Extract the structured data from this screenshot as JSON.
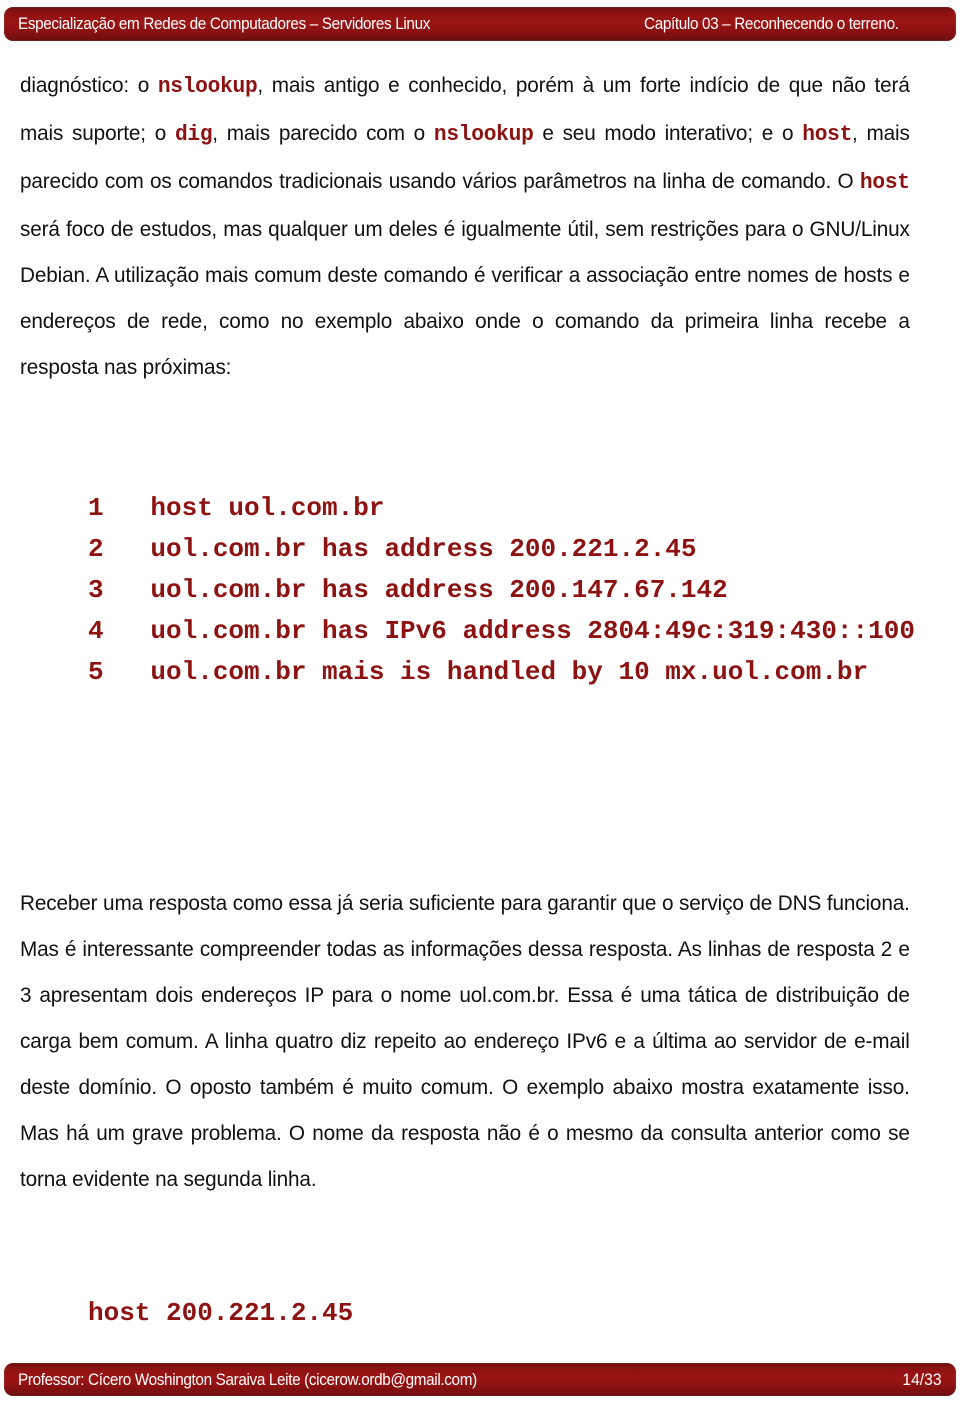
{
  "header": {
    "course_title": "Especialização em Redes de Computadores – Servidores Linux",
    "chapter": "Capítulo 03 – Reconhecendo o terreno."
  },
  "footer": {
    "professor": "Professor: Cícero Woshington Saraiva Leite (cicerow.ordb@gmail.com)",
    "page": "14/33"
  },
  "colors": {
    "bar_red": "#8e1212",
    "code_red": "#8d1313",
    "body_text": "#111111",
    "page_background": "#ffffff"
  },
  "body": {
    "paragraph_1": {
      "run_1": "diagnóstico: o ",
      "code_1": "nslookup",
      "run_2": ", mais antigo e conhecido, porém à um forte indício de que não terá mais suporte; o ",
      "code_2": "dig",
      "run_3": ", mais parecido com o ",
      "code_3": "nslookup",
      "run_4": " e seu modo interativo; e o ",
      "code_4": "host",
      "run_5": ", mais parecido com os comandos tradicionais usando vários parâmetros na linha de comando. O ",
      "code_5": "host",
      "run_6": " será foco de estudos, mas qualquer um deles é igualmente útil, sem restrições para o GNU/Linux Debian. A utilização mais comum deste comando é verificar a associação entre nomes de hosts e endereços de rede, como no exemplo abaixo onde o comando da primeira linha recebe a resposta nas próximas:"
    },
    "code_block_1": {
      "lines": [
        "1   host uol.com.br",
        "2   uol.com.br has address 200.221.2.45",
        "3   uol.com.br has address 200.147.67.142",
        "4   uol.com.br has IPv6 address 2804:49c:319:430::100",
        "5   uol.com.br mais is handled by 10 mx.uol.com.br"
      ]
    },
    "paragraph_2": "Receber uma resposta como essa já seria suficiente para garantir que o serviço de DNS funciona. Mas é interessante compreender todas as informações dessa resposta. As linhas de resposta 2 e 3 apresentam dois endereços IP para o nome uol.com.br. Essa é uma tática de distribuição de carga bem comum. A linha quatro diz repeito ao endereço IPv6 e a última ao servidor de e-mail deste domínio. O oposto também é muito comum. O exemplo abaixo mostra exatamente isso. Mas há um grave problema. O nome da resposta não é o mesmo da consulta anterior como se torna evidente na segunda linha.",
    "code_block_2": {
      "lines": [
        "host 200.221.2.45"
      ]
    }
  }
}
